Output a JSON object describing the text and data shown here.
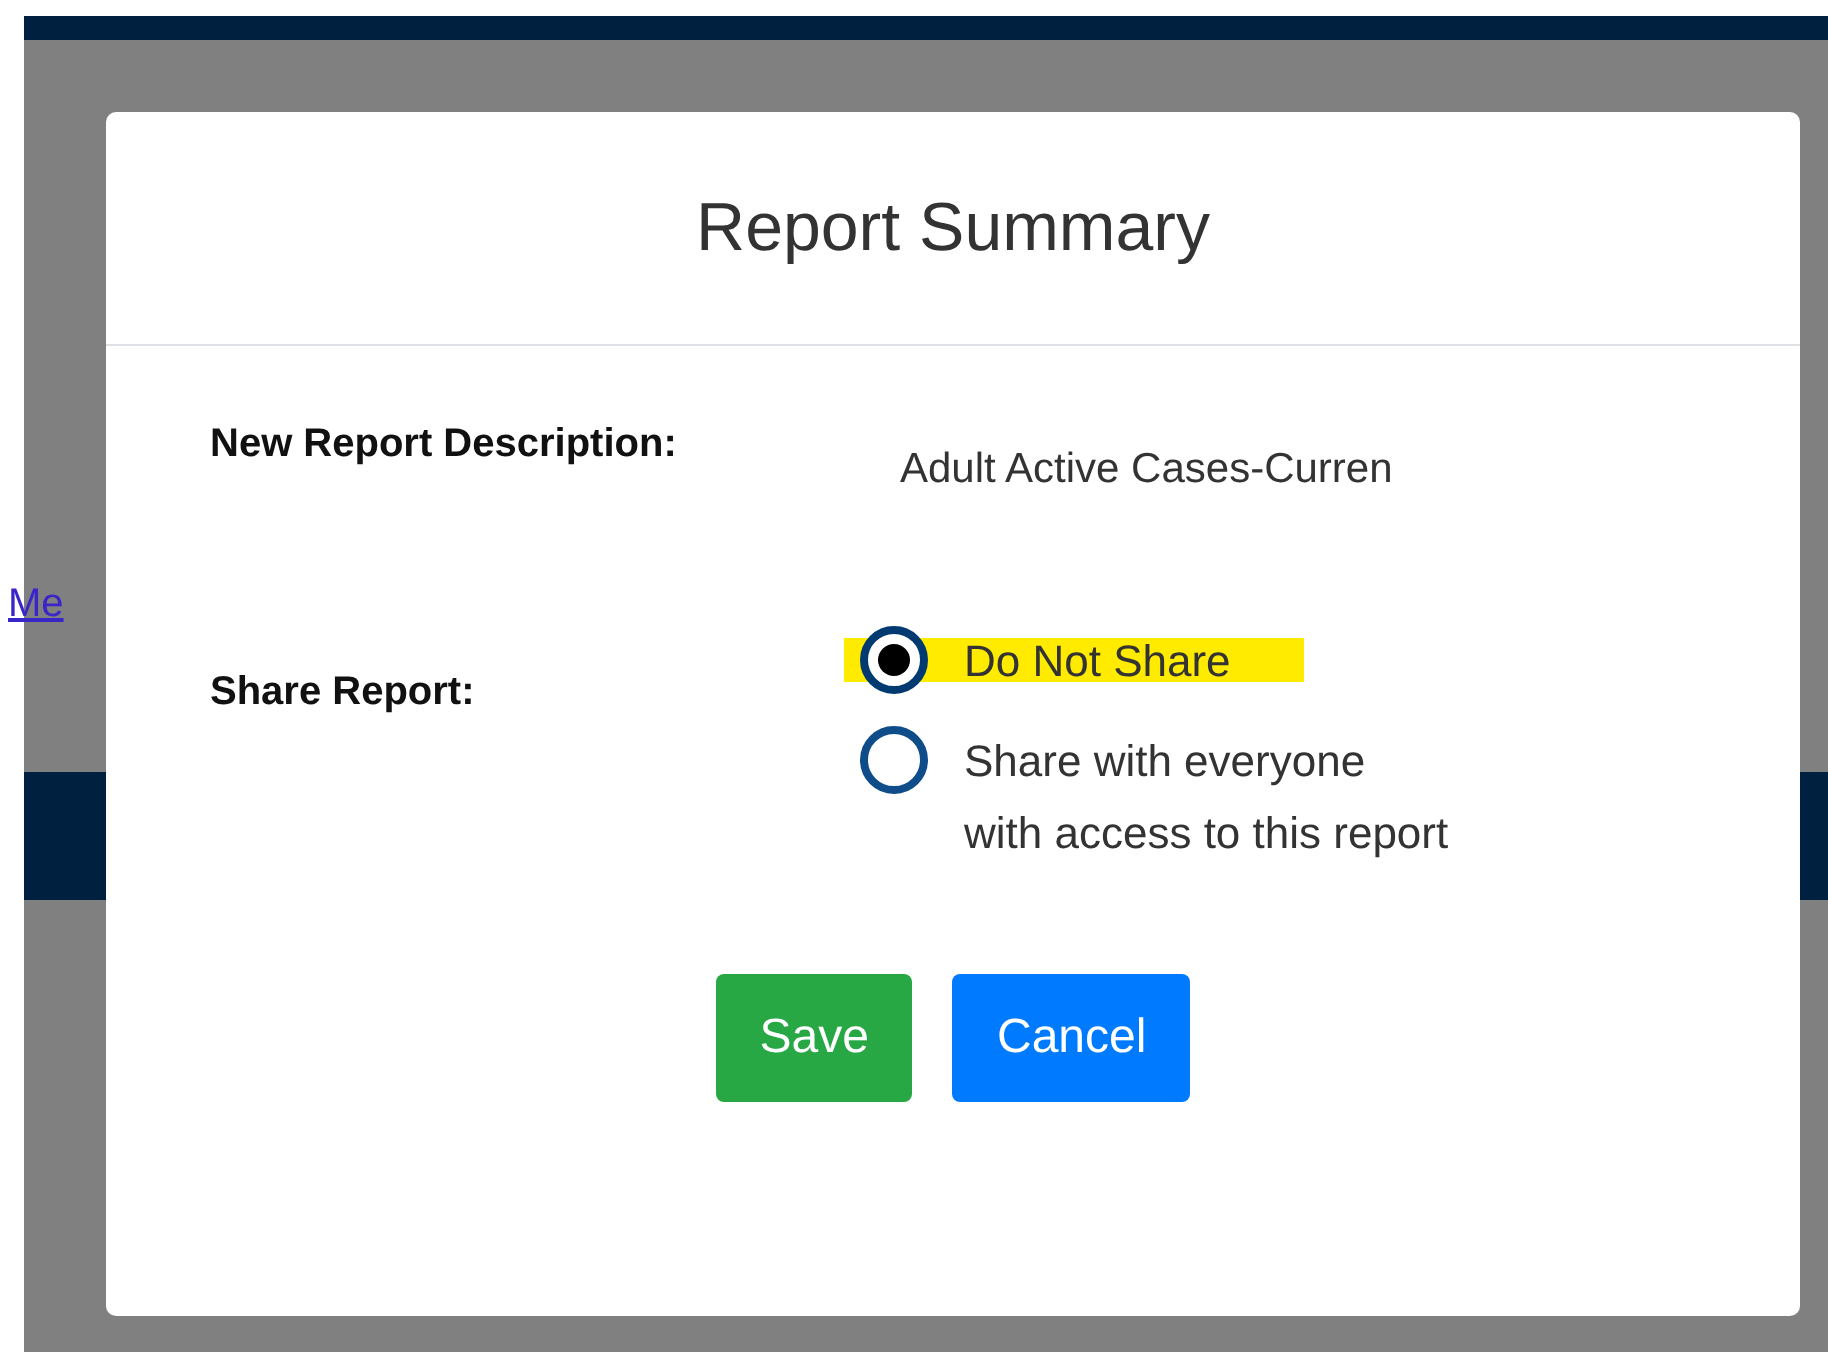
{
  "background": {
    "link": "Me"
  },
  "dialog": {
    "title": "Report Summary",
    "description_label": "New Report Description:",
    "description_value": "Adult Active Cases-Curren",
    "share_label": "Share Report:",
    "share_options": [
      {
        "lines": [
          "Do Not Share"
        ],
        "selected": true,
        "highlighted": true
      },
      {
        "lines": [
          "Share with everyone",
          "with access to this report"
        ],
        "selected": false,
        "highlighted": false
      }
    ],
    "buttons": [
      {
        "label": "Save",
        "kind": "save"
      },
      {
        "label": "Cancel",
        "kind": "cancel"
      }
    ]
  }
}
